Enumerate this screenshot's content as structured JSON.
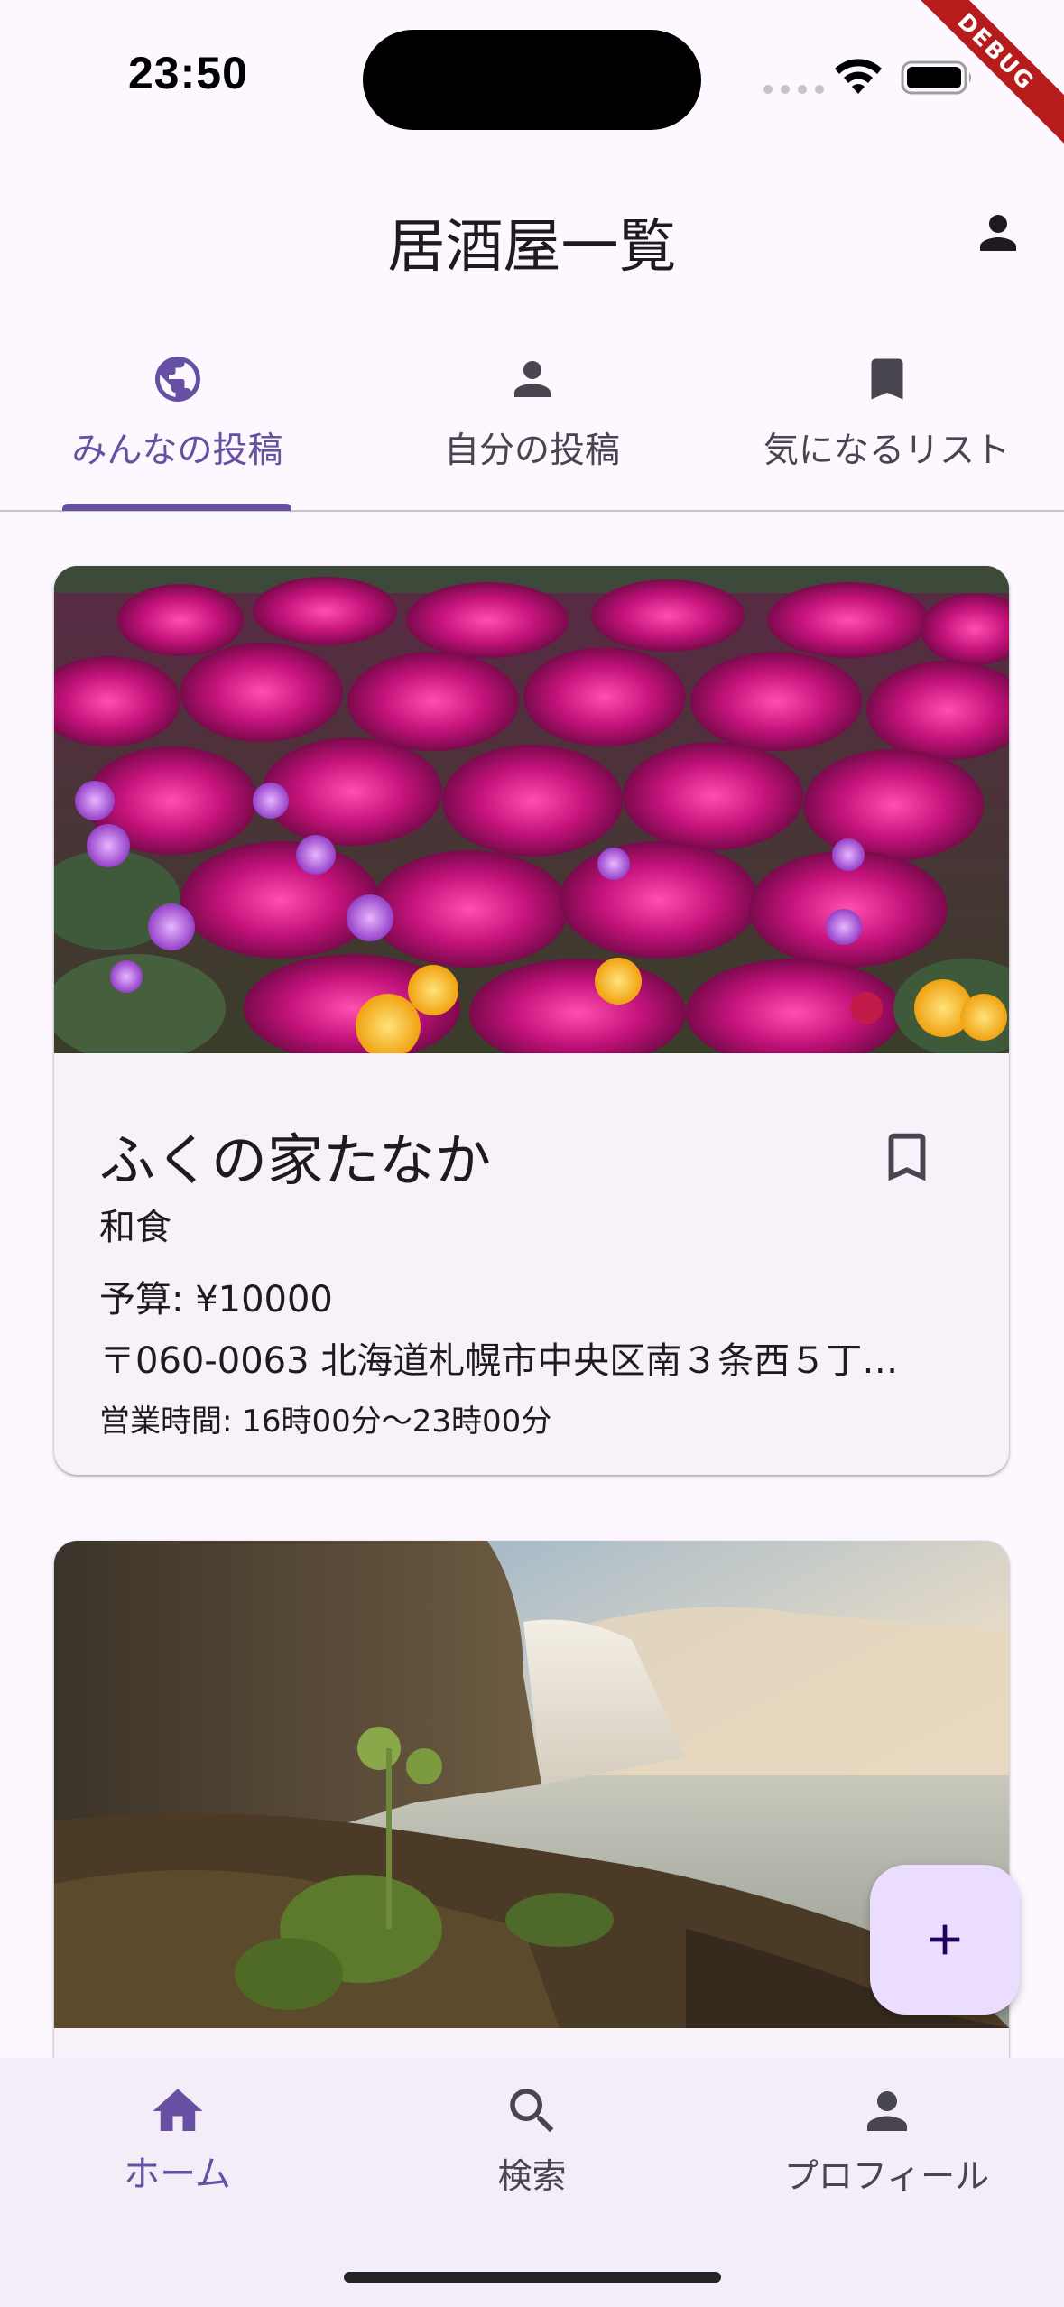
{
  "status_bar": {
    "time": "23:50",
    "debug_label": "DEBUG"
  },
  "app_bar": {
    "title": "居酒屋一覧",
    "account_icon": "person-icon"
  },
  "tabs": [
    {
      "label": "みんなの投稿",
      "icon": "globe-icon",
      "active": true
    },
    {
      "label": "自分の投稿",
      "icon": "person-icon",
      "active": false
    },
    {
      "label": "気になるリスト",
      "icon": "bookmark-icon",
      "active": false
    }
  ],
  "cards": [
    {
      "image": "pink-flowers-photo",
      "name": "ふくの家たなか",
      "genre": "和食",
      "budget": "予算: ¥10000",
      "address": "〒060-0063 北海道札幌市中央区南３条西５丁…",
      "hours": "営業時間: 16時00分〜23時00分"
    },
    {
      "image": "waterfall-photo"
    }
  ],
  "fab": {
    "icon": "plus-icon"
  },
  "bottom_nav": [
    {
      "label": "ホーム",
      "icon": "home-icon",
      "active": true
    },
    {
      "label": "検索",
      "icon": "search-icon",
      "active": false
    },
    {
      "label": "プロフィール",
      "icon": "person-icon",
      "active": false
    }
  ],
  "colors": {
    "primary": "#6750a4",
    "background": "#fdf7ff",
    "card": "#f7f2fa",
    "fab": "#eaddff",
    "nav_bar": "#f3edf7"
  }
}
